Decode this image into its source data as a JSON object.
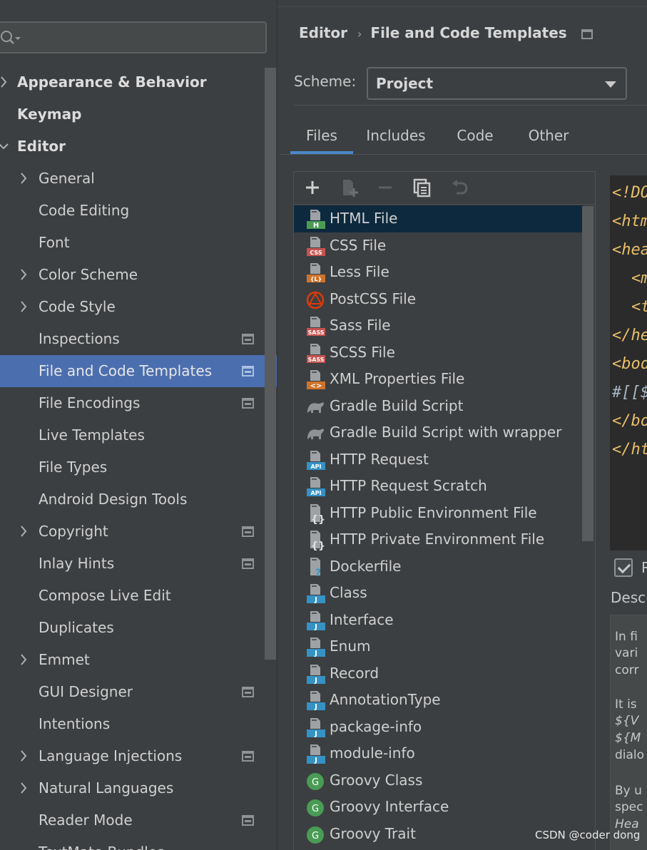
{
  "sidebar": {
    "items": [
      {
        "label": "Appearance & Behavior",
        "level": 0,
        "chevron": "collapsed",
        "project_icon": false
      },
      {
        "label": "Keymap",
        "level": 0,
        "chevron": "none",
        "project_icon": false
      },
      {
        "label": "Editor",
        "level": 0,
        "chevron": "expanded",
        "project_icon": false
      },
      {
        "label": "General",
        "level": 1,
        "chevron": "collapsed",
        "project_icon": false
      },
      {
        "label": "Code Editing",
        "level": 1,
        "chevron": "none",
        "project_icon": false
      },
      {
        "label": "Font",
        "level": 1,
        "chevron": "none",
        "project_icon": false
      },
      {
        "label": "Color Scheme",
        "level": 1,
        "chevron": "collapsed",
        "project_icon": false
      },
      {
        "label": "Code Style",
        "level": 1,
        "chevron": "collapsed",
        "project_icon": false
      },
      {
        "label": "Inspections",
        "level": 1,
        "chevron": "none",
        "project_icon": true
      },
      {
        "label": "File and Code Templates",
        "level": 1,
        "chevron": "none",
        "project_icon": true,
        "selected": true
      },
      {
        "label": "File Encodings",
        "level": 1,
        "chevron": "none",
        "project_icon": true
      },
      {
        "label": "Live Templates",
        "level": 1,
        "chevron": "none",
        "project_icon": false
      },
      {
        "label": "File Types",
        "level": 1,
        "chevron": "none",
        "project_icon": false
      },
      {
        "label": "Android Design Tools",
        "level": 1,
        "chevron": "none",
        "project_icon": false
      },
      {
        "label": "Copyright",
        "level": 1,
        "chevron": "collapsed",
        "project_icon": true
      },
      {
        "label": "Inlay Hints",
        "level": 1,
        "chevron": "none",
        "project_icon": true
      },
      {
        "label": "Compose Live Edit",
        "level": 1,
        "chevron": "none",
        "project_icon": false
      },
      {
        "label": "Duplicates",
        "level": 1,
        "chevron": "none",
        "project_icon": false
      },
      {
        "label": "Emmet",
        "level": 1,
        "chevron": "collapsed",
        "project_icon": false
      },
      {
        "label": "GUI Designer",
        "level": 1,
        "chevron": "none",
        "project_icon": true
      },
      {
        "label": "Intentions",
        "level": 1,
        "chevron": "none",
        "project_icon": false
      },
      {
        "label": "Language Injections",
        "level": 1,
        "chevron": "collapsed",
        "project_icon": true
      },
      {
        "label": "Natural Languages",
        "level": 1,
        "chevron": "collapsed",
        "project_icon": false
      },
      {
        "label": "Reader Mode",
        "level": 1,
        "chevron": "none",
        "project_icon": true
      },
      {
        "label": "TextMate Bundles",
        "level": 1,
        "chevron": "none",
        "project_icon": false
      }
    ]
  },
  "header": {
    "breadcrumb": [
      "Editor",
      "File and Code Templates"
    ],
    "separator": "›"
  },
  "scheme": {
    "label": "Scheme:",
    "value": "Project"
  },
  "tabs": [
    {
      "label": "Files",
      "active": true
    },
    {
      "label": "Includes",
      "active": false
    },
    {
      "label": "Code",
      "active": false
    },
    {
      "label": "Other",
      "active": false
    }
  ],
  "toolbar": {
    "buttons": [
      {
        "name": "add-icon",
        "enabled": true
      },
      {
        "name": "add-child-icon",
        "enabled": false
      },
      {
        "name": "remove-icon",
        "enabled": false
      },
      {
        "name": "copy-icon",
        "enabled": true
      },
      {
        "name": "reset-icon",
        "enabled": false
      }
    ]
  },
  "templates": [
    {
      "label": "HTML File",
      "icon": "html",
      "badge": "H",
      "selected": true
    },
    {
      "label": "CSS File",
      "icon": "css",
      "badge": "CSS"
    },
    {
      "label": "Less File",
      "icon": "less",
      "badge": "{L}"
    },
    {
      "label": "PostCSS File",
      "icon": "postcss",
      "badge": ""
    },
    {
      "label": "Sass File",
      "icon": "sass",
      "badge": "SASS"
    },
    {
      "label": "SCSS File",
      "icon": "scss",
      "badge": "SASS"
    },
    {
      "label": "XML Properties File",
      "icon": "xml",
      "badge": "<>"
    },
    {
      "label": "Gradle Build Script",
      "icon": "gradle",
      "badge": ""
    },
    {
      "label": "Gradle Build Script with wrapper",
      "icon": "gradle",
      "badge": ""
    },
    {
      "label": "HTTP Request",
      "icon": "api",
      "badge": "API"
    },
    {
      "label": "HTTP Request Scratch",
      "icon": "api",
      "badge": "API"
    },
    {
      "label": "HTTP Public Environment File",
      "icon": "env",
      "badge": "{}"
    },
    {
      "label": "HTTP Private Environment File",
      "icon": "env",
      "badge": "{}"
    },
    {
      "label": "Dockerfile",
      "icon": "docker",
      "badge": "?"
    },
    {
      "label": "Class",
      "icon": "java",
      "badge": "J"
    },
    {
      "label": "Interface",
      "icon": "java",
      "badge": "J"
    },
    {
      "label": "Enum",
      "icon": "java",
      "badge": "J"
    },
    {
      "label": "Record",
      "icon": "java",
      "badge": "J"
    },
    {
      "label": "AnnotationType",
      "icon": "java",
      "badge": "J"
    },
    {
      "label": "package-info",
      "icon": "java",
      "badge": "J"
    },
    {
      "label": "module-info",
      "icon": "java",
      "badge": "J"
    },
    {
      "label": "Groovy Class",
      "icon": "groovy",
      "badge": "G"
    },
    {
      "label": "Groovy Interface",
      "icon": "groovy",
      "badge": "G"
    },
    {
      "label": "Groovy Trait",
      "icon": "groovy",
      "badge": "G"
    }
  ],
  "editor": {
    "lines": [
      "<!DO",
      "<htm",
      "<hea",
      "<m",
      "<t",
      "</he",
      "<bod",
      "#[[$",
      "</bo",
      "</ht"
    ]
  },
  "reformat": {
    "label": "R",
    "checked": true
  },
  "description": {
    "label": "Descr",
    "lines": [
      "In fi",
      "vari",
      "corr",
      "",
      "It is",
      "${V",
      "${M",
      "dialo",
      "",
      "By u",
      "spec",
      "Hea"
    ]
  },
  "watermark": "CSDN @coder dong",
  "colors": {
    "accent": "#4b6eaf",
    "list_selection": "#0d293e",
    "tab_underline": "#4a88c7",
    "code_tag": "#e8bf6a"
  }
}
